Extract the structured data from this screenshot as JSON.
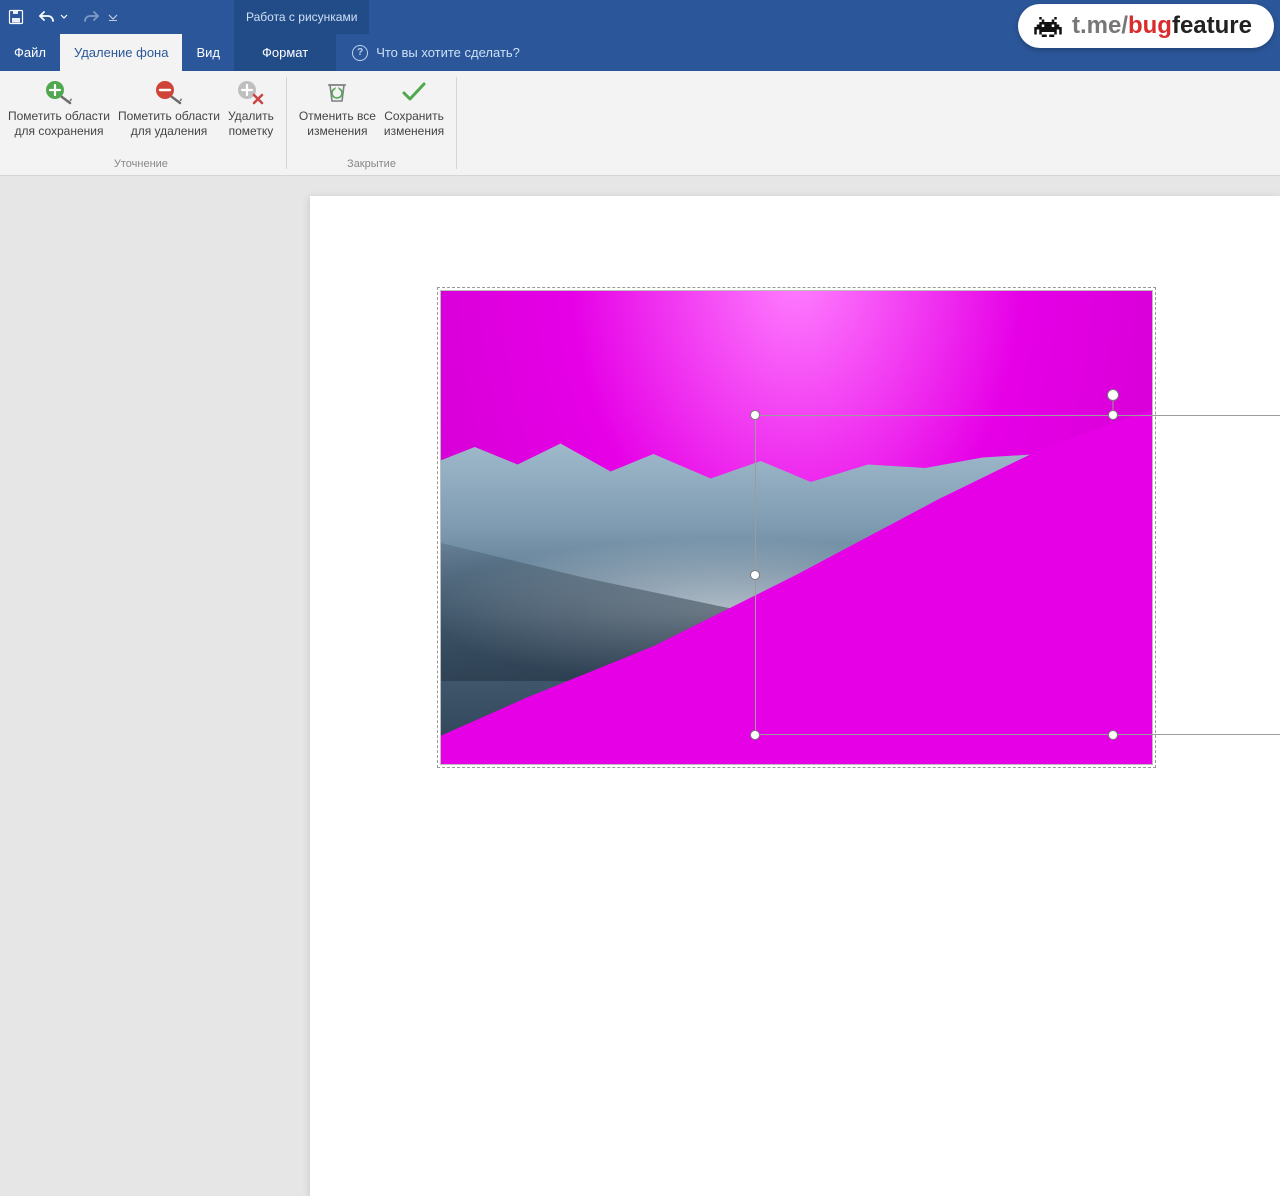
{
  "app": {
    "context_tab_title": "Работа с рисунками",
    "tellme_placeholder": "Что вы хотите сделать?"
  },
  "tabs": {
    "file": "Файл",
    "remove_bg": "Удаление фона",
    "view": "Вид",
    "format": "Формат"
  },
  "ribbon": {
    "refine_group": "Уточнение",
    "close_group": "Закрытие",
    "mark_keep_l1": "Пометить области",
    "mark_keep_l2": "для сохранения",
    "mark_remove_l1": "Пометить области",
    "mark_remove_l2": "для удаления",
    "delete_mark_l1": "Удалить",
    "delete_mark_l2": "пометку",
    "discard_l1": "Отменить все",
    "discard_l2": "изменения",
    "keep_l1": "Сохранить",
    "keep_l2": "изменения"
  },
  "watermark": {
    "prefix": "t.me/",
    "red": "bug",
    "suffix": "feature"
  },
  "colors": {
    "brand": "#2b579a",
    "remove_overlay": "#e600e6"
  },
  "icons": {
    "save": "save-icon",
    "undo": "undo-icon",
    "redo": "redo-icon",
    "mark_keep": "plus-circle-green-icon",
    "mark_remove": "minus-circle-red-icon",
    "delete_mark": "plus-circle-gray-x-icon",
    "discard": "recycle-bucket-icon",
    "keep": "checkmark-icon",
    "tellme": "lightbulb-icon"
  }
}
